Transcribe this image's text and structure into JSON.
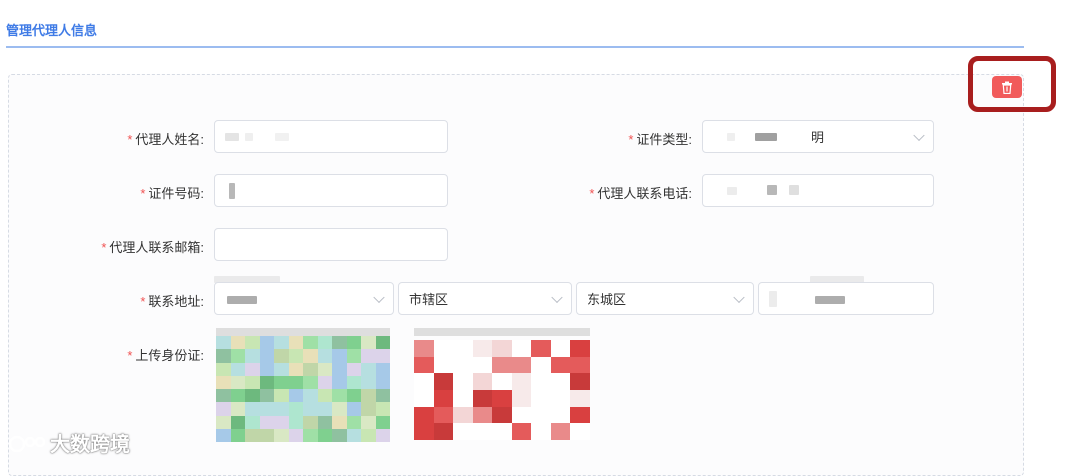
{
  "section": {
    "title": "管理代理人信息"
  },
  "colors": {
    "accent": "#3f7be6",
    "danger": "#f15b5b",
    "required": "#f05151",
    "highlight": "#a81e1e"
  },
  "actions": {
    "delete_icon": "trash-icon"
  },
  "form": {
    "required_mark": "*",
    "agent_name": {
      "label": "代理人姓名:",
      "value": ""
    },
    "id_type": {
      "label": "证件类型:",
      "value": "明"
    },
    "id_number": {
      "label": "证件号码:",
      "value": ""
    },
    "agent_phone": {
      "label": "代理人联系电话:",
      "value": ""
    },
    "agent_email": {
      "label": "代理人联系邮箱:",
      "value": ""
    },
    "address": {
      "label": "联系地址:",
      "province": "",
      "city": "市辖区",
      "district": "东城区",
      "detail": ""
    },
    "id_upload": {
      "label": "上传身份证:"
    }
  },
  "watermark": {
    "text": "大数跨境"
  }
}
